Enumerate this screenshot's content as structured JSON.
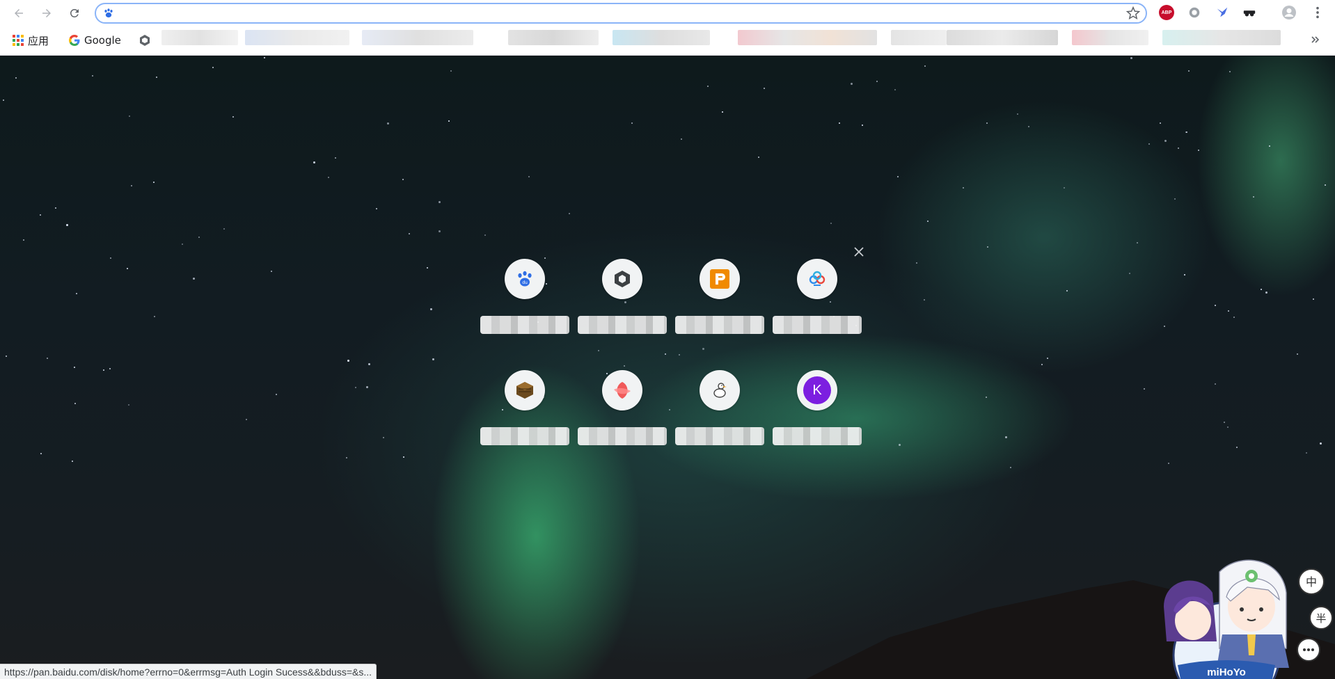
{
  "toolbar": {
    "omnibox_value": "",
    "site_icon": "baidu-paw-icon"
  },
  "extensions": {
    "abp_label": "ABP"
  },
  "bookmarks": {
    "apps_label": "应用",
    "google_label": "Google"
  },
  "ntp": {
    "tiles": [
      {
        "icon": "baidu-paw-icon",
        "letter": ""
      },
      {
        "icon": "hexagon-cube-icon",
        "letter": ""
      },
      {
        "icon": "orange-p-icon",
        "letter": ""
      },
      {
        "icon": "cloud-drive-icon",
        "letter": ""
      },
      {
        "icon": "wooden-block-icon",
        "letter": ""
      },
      {
        "icon": "red-leaf-icon",
        "letter": ""
      },
      {
        "icon": "goose-icon",
        "letter": ""
      },
      {
        "icon": "letter-k-icon",
        "letter": "K"
      }
    ]
  },
  "status": {
    "url": "https://pan.baidu.com/disk/home?errno=0&errmsg=Auth Login Sucess&&bduss=&s..."
  },
  "mascot": {
    "brand": "miHoYo",
    "bubbles": [
      "中",
      "半"
    ]
  },
  "colors": {
    "accent": "#8ab4f8",
    "k_tile": "#7c1fe0",
    "abp": "#c70d2c"
  }
}
